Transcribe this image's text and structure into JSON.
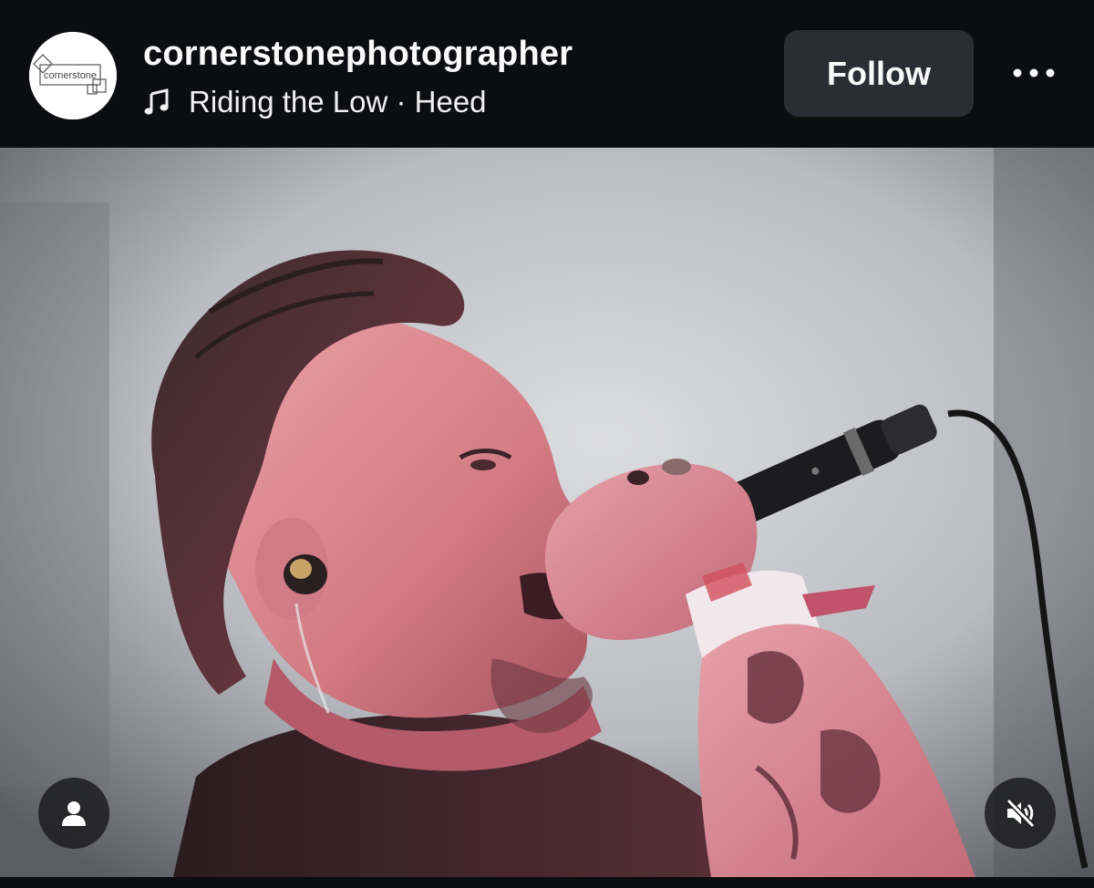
{
  "post": {
    "avatar_text": "cornerstone",
    "username": "cornerstonephotographer",
    "audio": {
      "icon": "music-note-icon",
      "track": "Riding the Low",
      "separator": "·",
      "artist": "Heed",
      "label": "Riding the Low · Heed"
    },
    "follow_label": "Follow",
    "more_icon": "more-horizontal-icon"
  },
  "media": {
    "description": "Singer with slicked-back hair and in-ear monitor singing into a handheld microphone, festival wristbands on wrist, tattooed forearm, stage lit in pink tones",
    "tag_icon": "user-icon",
    "mute_icon": "speaker-muted-icon"
  },
  "colors": {
    "background": "#0b0d10",
    "button_bg": "#2a2d33",
    "text": "#fafafa"
  }
}
